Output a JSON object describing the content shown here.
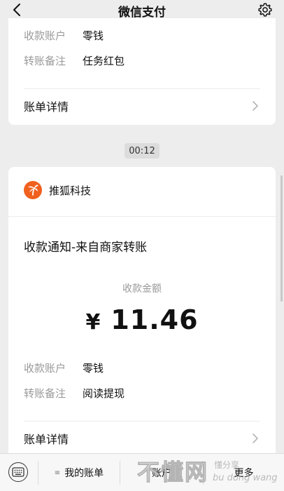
{
  "header": {
    "title": "微信支付"
  },
  "card_prev": {
    "rows": [
      {
        "label": "收款账户",
        "value": "零钱"
      },
      {
        "label": "转账备注",
        "value": "任务红包"
      }
    ],
    "detail_label": "账单详情"
  },
  "timestamp": "00:12",
  "card_main": {
    "merchant_name": "推狐科技",
    "notice_title": "收款通知-来自商家转账",
    "amount_label": "收款金额",
    "currency": "¥",
    "amount": "11.46",
    "rows": [
      {
        "label": "收款账户",
        "value": "零钱"
      },
      {
        "label": "转账备注",
        "value": "阅读提现"
      }
    ],
    "detail_label": "账单详情"
  },
  "bottom_bar": {
    "tabs": [
      {
        "label": "我的账单"
      },
      {
        "label": "账户"
      },
      {
        "label": "更多"
      }
    ]
  },
  "watermark": {
    "main": "不懂网",
    "sub1": "懂分享",
    "sub2": "bu dong wang"
  },
  "colors": {
    "background": "#ededed",
    "card": "#ffffff",
    "logo": "#f0601e",
    "muted_text": "#999999"
  }
}
